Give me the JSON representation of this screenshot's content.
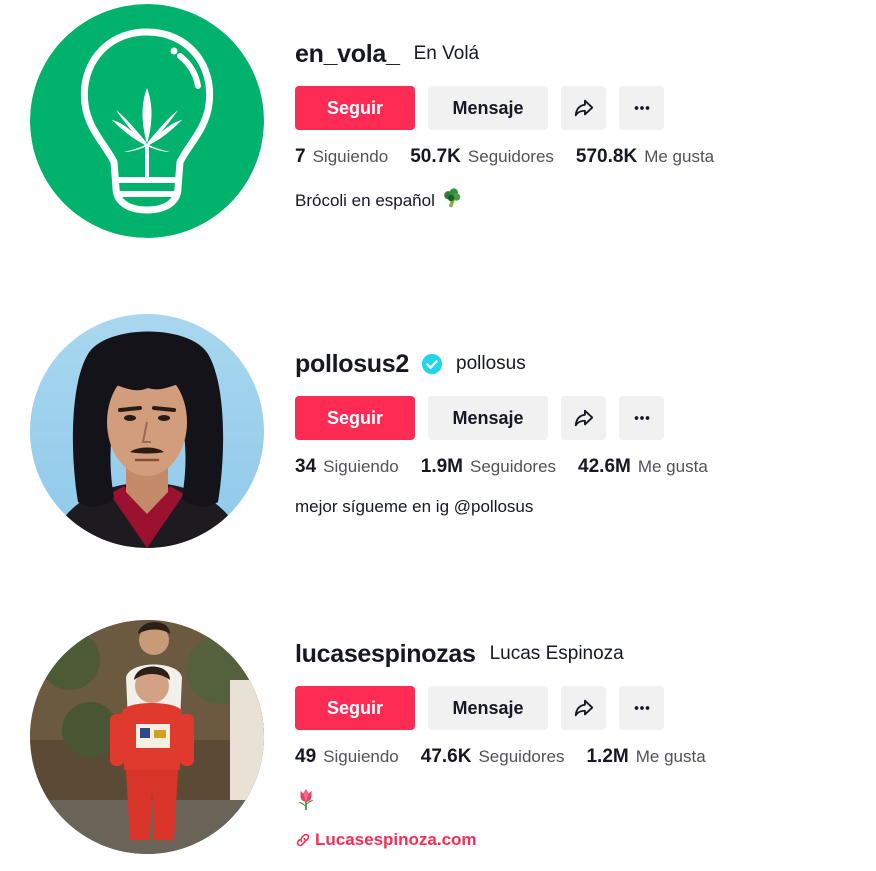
{
  "profiles": [
    {
      "username": "en_vola_",
      "nickname": "En Volá",
      "verified": false,
      "follow_label": "Seguir",
      "message_label": "Mensaje",
      "following_count": "7",
      "following_label": "Siguiendo",
      "followers_count": "50.7K",
      "followers_label": "Seguidores",
      "likes_count": "570.8K",
      "likes_label": "Me gusta",
      "bio": "Brócoli en español",
      "bio_emoji": "broccoli",
      "avatar": "green-lightbulb-leaf-logo"
    },
    {
      "username": "pollosus2",
      "nickname": "pollosus",
      "verified": true,
      "follow_label": "Seguir",
      "message_label": "Mensaje",
      "following_count": "34",
      "following_label": "Siguiendo",
      "followers_count": "1.9M",
      "followers_label": "Seguidores",
      "likes_count": "42.6M",
      "likes_label": "Me gusta",
      "bio": "mejor sígueme en ig @pollosus",
      "avatar": "man-with-mullet-photo"
    },
    {
      "username": "lucasespinozas",
      "nickname": "Lucas Espinoza",
      "verified": false,
      "follow_label": "Seguir",
      "message_label": "Mensaje",
      "following_count": "49",
      "following_label": "Siguiendo",
      "followers_count": "47.6K",
      "followers_label": "Seguidores",
      "likes_count": "1.2M",
      "likes_label": "Me gusta",
      "bio_emoji": "tulip",
      "link": "Lucasespinoza.com",
      "avatar": "vintage-children-photo"
    }
  ],
  "colors": {
    "accent": "#fe2c55",
    "button_gray": "#f1f1f2",
    "text_primary": "#161823",
    "text_secondary": "#51525a",
    "verified_blue": "#20d5ec",
    "logo_green": "#00b26b"
  }
}
